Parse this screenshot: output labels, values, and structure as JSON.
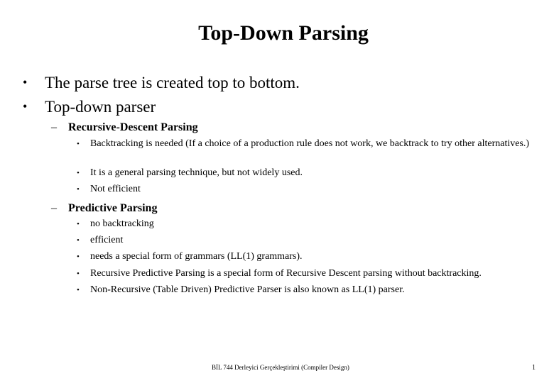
{
  "slide": {
    "title": "Top-Down Parsing",
    "bullets": [
      {
        "marker": "•",
        "text": "The parse tree is created top to bottom."
      },
      {
        "marker": "•",
        "text": "Top-down parser"
      }
    ],
    "sections": [
      {
        "marker": "–",
        "heading": "Recursive-Descent Parsing",
        "items": [
          {
            "marker": "•",
            "text": "Backtracking is needed (If a choice of a production rule does not work, we backtrack to try other alternatives.)"
          },
          {
            "marker": "•",
            "text": "It is a general parsing technique, but not widely used."
          },
          {
            "marker": "•",
            "text": "Not efficient"
          }
        ]
      },
      {
        "marker": "–",
        "heading": "Predictive Parsing",
        "items": [
          {
            "marker": "•",
            "text": "no backtracking"
          },
          {
            "marker": "•",
            "text": "efficient"
          },
          {
            "marker": "•",
            "text": "needs a special form of grammars (LL(1) grammars)."
          },
          {
            "marker": "•",
            "text": "Recursive Predictive Parsing  is a special form of Recursive Descent parsing without backtracking."
          },
          {
            "marker": "•",
            "text": "Non-Recursive (Table Driven) Predictive Parser is also known as LL(1) parser."
          }
        ]
      }
    ],
    "footer": "BİL 744 Derleyici Gerçekleştirimi (Compiler Design)",
    "page_number": "1"
  }
}
